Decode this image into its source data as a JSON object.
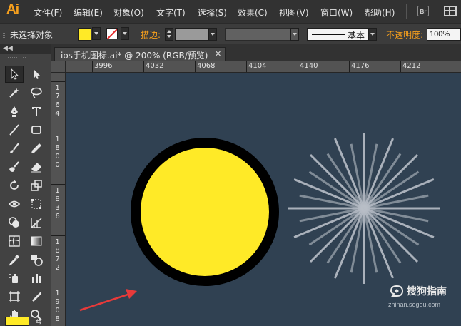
{
  "app": {
    "logo": "Ai"
  },
  "menu": [
    "文件(F)",
    "编辑(E)",
    "对象(O)",
    "文字(T)",
    "选择(S)",
    "效果(C)",
    "视图(V)",
    "窗口(W)",
    "帮助(H)"
  ],
  "menu_right": {
    "bridge_label": "Br"
  },
  "control_bar": {
    "selection_status": "未选择对象",
    "fill_color": "#ffea27",
    "stroke_color": "none",
    "stroke_label": "描边:",
    "brush_label": "基本",
    "opacity_label": "不透明度:",
    "opacity_value": "100%"
  },
  "document_tab": {
    "title": "ios手机图标.ai* @ 200% (RGB/预览)",
    "close": "✕"
  },
  "rulers": {
    "horizontal": [
      "3996",
      "4032",
      "4068",
      "4104",
      "4140",
      "4176",
      "4212"
    ],
    "vertical": [
      "1764",
      "1800",
      "1836",
      "1872",
      "1908"
    ]
  },
  "toolbar": {
    "collapse": "◀◀",
    "swap_icon": "⇆",
    "tools": [
      "selection-tool",
      "direct-selection-tool",
      "magic-wand-tool",
      "lasso-tool",
      "pen-tool",
      "type-tool",
      "line-tool",
      "rectangle-tool",
      "paintbrush-tool",
      "pencil-tool",
      "blob-brush-tool",
      "eraser-tool",
      "rotate-tool",
      "scale-tool",
      "width-tool",
      "free-transform-tool",
      "shape-builder-tool",
      "perspective-grid-tool",
      "mesh-tool",
      "gradient-tool",
      "eyedropper-tool",
      "blend-tool",
      "symbol-sprayer-tool",
      "column-graph-tool",
      "artboard-tool",
      "slice-tool",
      "hand-tool",
      "zoom-tool"
    ],
    "fill_color": "#ffea27"
  },
  "canvas": {
    "background": "#304152",
    "sun_fill": "#ffea27",
    "sun_stroke": "#000000",
    "ray_color": "#b8bec6",
    "arrow_color": "#e83a3a"
  },
  "watermark": {
    "title": "搜狗指南",
    "url": "zhinan.sogou.com"
  }
}
